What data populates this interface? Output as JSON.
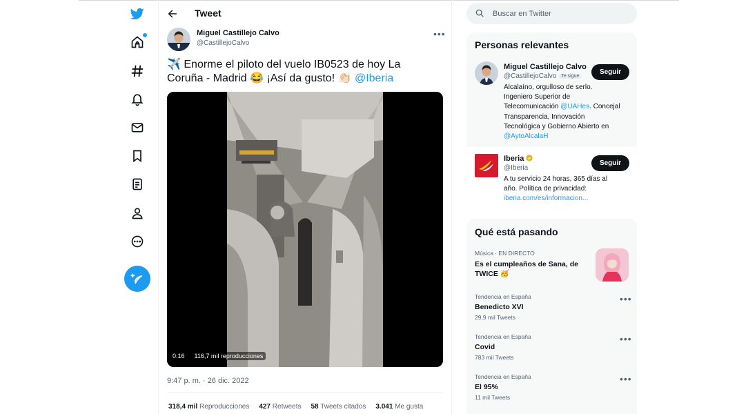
{
  "colors": {
    "accent": "#1d9bf0",
    "text": "#0f1419",
    "muted": "#536471",
    "panel": "#f7f9f9",
    "iberia_red": "#d7192d",
    "iberia_gold": "#ffcc00"
  },
  "nav": {
    "items": [
      {
        "name": "twitter-logo-icon"
      },
      {
        "name": "home-icon"
      },
      {
        "name": "hashtag-icon"
      },
      {
        "name": "bell-icon"
      },
      {
        "name": "mail-icon"
      },
      {
        "name": "bookmark-icon"
      },
      {
        "name": "list-icon"
      },
      {
        "name": "profile-icon"
      },
      {
        "name": "more-circle-icon"
      }
    ],
    "compose_icon": "feather-plus-icon"
  },
  "header": {
    "title": "Tweet",
    "back_icon": "arrow-left-icon"
  },
  "tweet": {
    "author_name": "Miguel Castillejo Calvo",
    "author_handle": "@CastillejoCalvo",
    "text_emoji_start": "✈️",
    "text_body": " Enorme el piloto del vuelo IB0523 de hoy La Coruña - Madrid ",
    "text_emoji_laugh": "😂",
    "text_body2": " ¡Así da gusto! ",
    "text_emoji_clap": "👏🏻",
    "text_mention": " @Iberia",
    "video_time": "0:16",
    "video_views": "116,7 mil reproducciones",
    "timestamp": "9:47 p. m. · 26 dic. 2022",
    "stats": [
      {
        "value": "318,4 mil",
        "label": "Reproducciones"
      },
      {
        "value": "427",
        "label": "Retweets"
      },
      {
        "value": "58",
        "label": "Tweets citados"
      },
      {
        "value": "3.041",
        "label": "Me gusta"
      }
    ]
  },
  "search": {
    "placeholder": "Buscar en Twitter"
  },
  "relevant_people": {
    "title": "Personas relevantes",
    "people": [
      {
        "name": "Miguel Castillejo Calvo",
        "handle": "@CastillejoCalvo",
        "follows_you": "Te sigue",
        "button": "Seguir",
        "bio_1": "Alcalaíno, orgulloso de serlo.",
        "bio_2": "Ingeniero Superior de",
        "bio_3a": "Telecomunicación ",
        "bio_3b": "@UAHes",
        "bio_3c": ". Concejal",
        "bio_4": "Transparencia, Innovación",
        "bio_5": "Tecnológica y Gobierno Abierto en",
        "bio_6": "@AytoAlcalaH"
      },
      {
        "name": "Iberia",
        "handle": "@Iberia",
        "button": "Seguir",
        "bio_1": "A tu servicio 24 horas, 365 días al",
        "bio_2": "año. Política de privacidad:",
        "bio_3": "iberia.com/es/informacion..."
      }
    ]
  },
  "trends": {
    "title": "Qué está pasando",
    "items": [
      {
        "category": "Música · EN DIRECTO",
        "title_1": "Es el cumpleaños de Sana, de",
        "title_2": "TWICE 🥳",
        "count": ""
      },
      {
        "category": "Tendencia en España",
        "title_1": "Benedicto XVI",
        "count": "29,9 mil Tweets"
      },
      {
        "category": "Tendencia en España",
        "title_1": "Covid",
        "count": "783 mil Tweets"
      },
      {
        "category": "Tendencia en España",
        "title_1": "El 95%",
        "count": "11 mil Tweets"
      }
    ]
  }
}
